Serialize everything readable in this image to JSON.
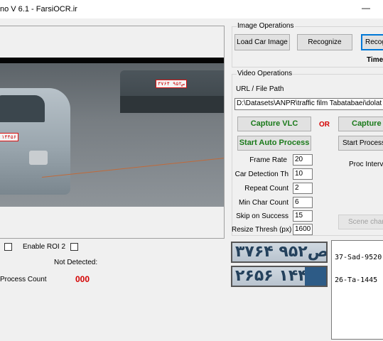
{
  "window": {
    "title": "no V 6.1 - FarsiOCR.ir",
    "minimize_glyph": "—"
  },
  "video": {
    "plates": [
      "۳۷ص۹۵۲ ۶۴",
      "۱۴۴۵۶"
    ]
  },
  "roi": {
    "enable_roi2_label": "Enable ROI 2"
  },
  "status": {
    "not_detected_label": "Not Detected:",
    "process_count_label": "Process Count",
    "process_count_value": "000",
    "process_count_color": "#d40000"
  },
  "image_ops": {
    "title": "Image Operations",
    "load_button": "Load Car Image",
    "recognize_button": "Recognize",
    "recognize2_button": "Recog",
    "time_label": "Time:"
  },
  "video_ops": {
    "title": "Video Operations",
    "url_label": "URL / File Path",
    "url_value": "D:\\Datasets\\ANPR\\traffic film Tabatabaei\\dolat ab",
    "capture_vlc": "Capture VLC",
    "or_label": "OR",
    "capture": "Capture",
    "start_auto": "Start Auto Process",
    "start_processing": "Start Processin",
    "proc_interval_label": "Proc Interva",
    "scene_change_button": "Scene char",
    "params": [
      {
        "label": "Frame Rate",
        "value": "20"
      },
      {
        "label": "Car Detection Th",
        "value": "10"
      },
      {
        "label": "Repeat Count",
        "value": "2"
      },
      {
        "label": "Min Char Count",
        "value": "6"
      },
      {
        "label": "Skip on Success",
        "value": "15"
      },
      {
        "label": "Resize Thresh (px)",
        "value": "1600"
      }
    ]
  },
  "recognized": {
    "plates": [
      {
        "image_text": "۳۷ص۹۵۲ ۶۴",
        "text": "37-Sad-9520"
      },
      {
        "image_text": "۲۶ط۱۴۴ ۵۶",
        "text": "26-Ta-1445"
      }
    ]
  }
}
